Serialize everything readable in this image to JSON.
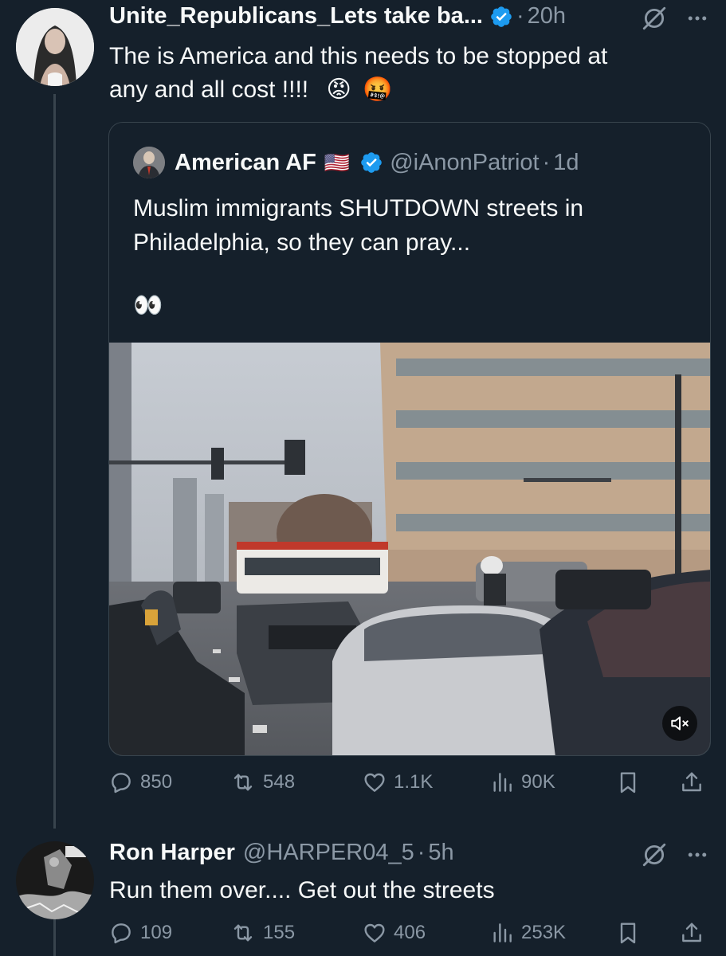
{
  "colors": {
    "background": "#15202b",
    "primary_text": "#f7f9f9",
    "secondary_text": "#8b98a5",
    "border": "#38444d",
    "verified_blue": "#1d9bf0"
  },
  "post1": {
    "display_name": "Unite_Republicans_Lets take ba...",
    "dot": "·",
    "time": "20h",
    "text_line1": "The is America and this needs to be stopped at",
    "text_line2": "any and all cost !!!!",
    "emoji1": "😡",
    "emoji2": "🤬",
    "icons": [
      "verified-badge",
      "grok-icon",
      "more-icon"
    ]
  },
  "quote": {
    "display_name": "American AF",
    "flag": "🇺🇸",
    "handle": "@iAnonPatriot",
    "dot": "·",
    "time": "1d",
    "text": "Muslim immigrants SHUTDOWN streets in Philadelphia, so they can pray...",
    "eyes": "👀",
    "media_alt": "video of a city street with cars and a traffic light"
  },
  "post1_actions": {
    "replies": "850",
    "reposts": "548",
    "likes": "1.1K",
    "views": "90K"
  },
  "post2": {
    "display_name": "Ron Harper",
    "handle": "@HARPER04_5",
    "dot": "·",
    "time": "5h",
    "text": "Run them over.... Get out the streets"
  },
  "post2_actions": {
    "replies": "109",
    "reposts": "155",
    "likes": "406",
    "views": "253K"
  }
}
